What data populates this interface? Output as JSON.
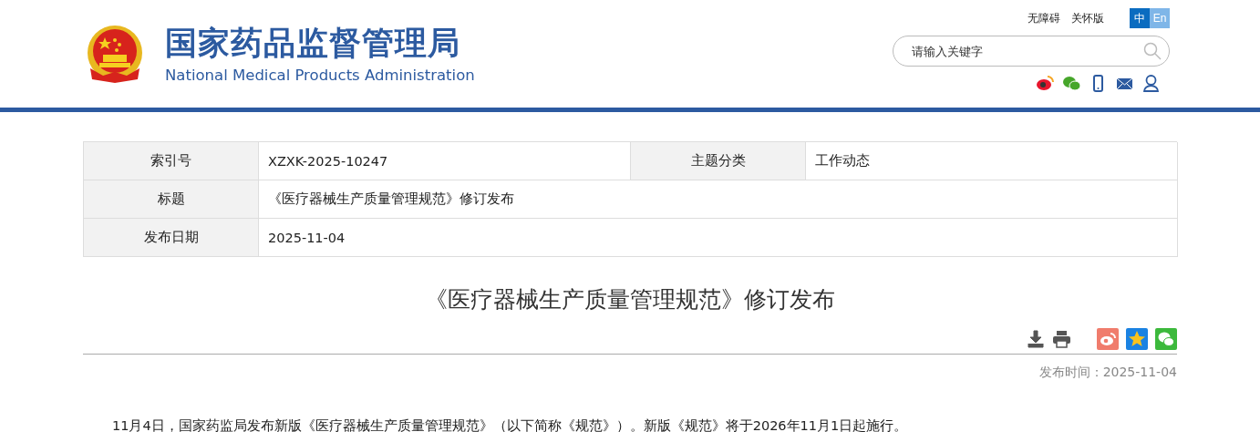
{
  "header": {
    "logo_title": "国家药品监督管理局",
    "logo_subtitle": "National Medical Products Administration",
    "links": [
      "无障碍",
      "关怀版"
    ],
    "languages": [
      {
        "label": "中",
        "selected": true
      },
      {
        "label": "En",
        "selected": false
      }
    ],
    "search": {
      "placeholder": "请输入关键字"
    }
  },
  "info_table": {
    "rows": [
      {
        "cells": [
          {
            "label": "索引号",
            "value": "XZXK-2025-10247"
          },
          {
            "label": "主题分类",
            "value": "工作动态"
          }
        ]
      },
      {
        "cells": [
          {
            "label": "标题",
            "value": "《医疗器械生产质量管理规范》修订发布"
          }
        ]
      },
      {
        "cells": [
          {
            "label": "发布日期",
            "value": "2025-11-04"
          }
        ]
      }
    ]
  },
  "article": {
    "title": "《医疗器械生产质量管理规范》修订发布",
    "publish_time": "发布时间：2025-11-04",
    "paragraph": "11月4日，国家药监局发布新版《医疗器械生产质量管理规范》（以下简称《规范》）。新版《规范》将于2026年11月1日起施行。"
  }
}
